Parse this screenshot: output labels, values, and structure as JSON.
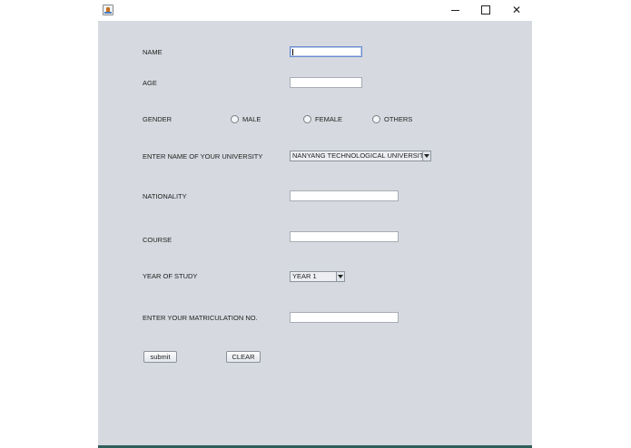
{
  "titlebar": {
    "minimize": "—",
    "maximize": "",
    "close": "✕"
  },
  "form": {
    "name": {
      "label": "NAME",
      "value": ""
    },
    "age": {
      "label": "AGE",
      "value": ""
    },
    "gender": {
      "label": "GENDER",
      "options": [
        "MALE",
        "FEMALE",
        "OTHERS"
      ]
    },
    "university": {
      "label": "ENTER NAME OF YOUR UNIVERSITY",
      "selected": "NANYANG TECHNOLOGICAL UNIVERSITY"
    },
    "nationality": {
      "label": "NATIONALITY",
      "value": ""
    },
    "course": {
      "label": "COURSE",
      "value": ""
    },
    "year": {
      "label": "YEAR OF STUDY",
      "selected": "YEAR 1"
    },
    "matric": {
      "label": "ENTER YOUR MATRICULATION NO.",
      "value": ""
    },
    "submit_label": "submit",
    "clear_label": "CLEAR"
  },
  "colors": {
    "window_bg": "#d6d9df",
    "focus_border": "#6a8ccf",
    "bottom_bar": "#2f5f5a"
  }
}
